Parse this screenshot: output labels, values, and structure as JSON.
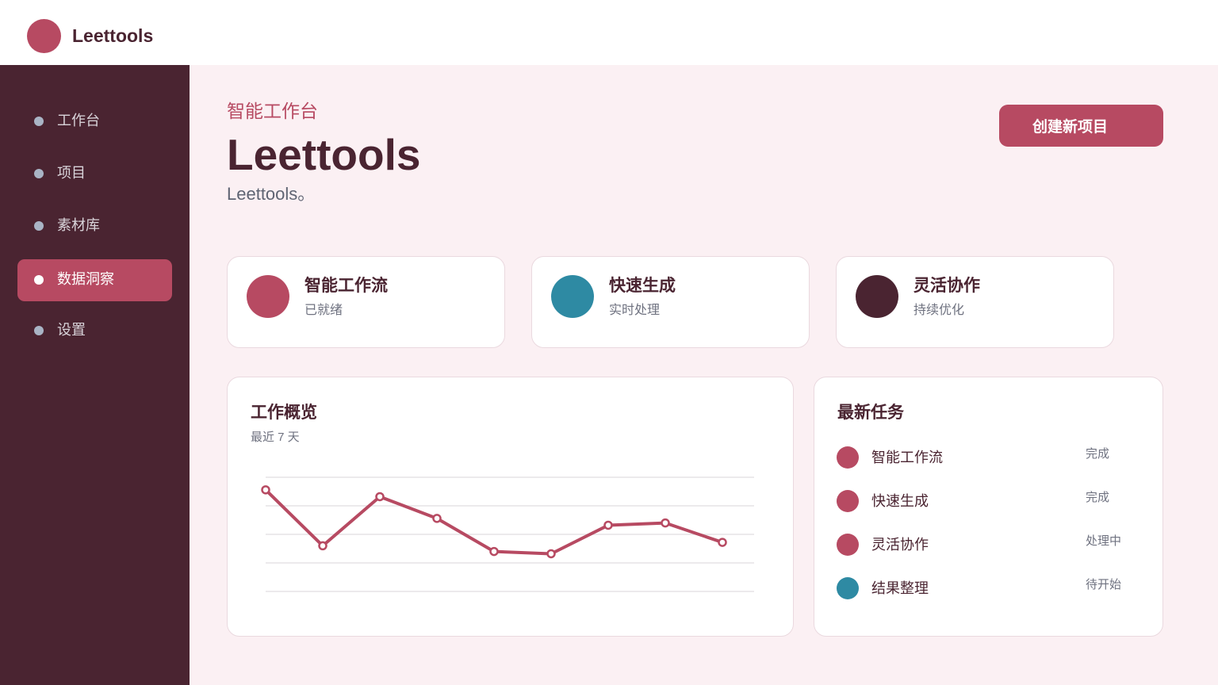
{
  "app": {
    "name": "Leettools"
  },
  "sidebar": {
    "items": [
      {
        "label": "工作台",
        "active": false
      },
      {
        "label": "项目",
        "active": false
      },
      {
        "label": "素材库",
        "active": false
      },
      {
        "label": "数据洞察",
        "active": true
      },
      {
        "label": "设置",
        "active": false
      }
    ]
  },
  "header": {
    "eyebrow": "智能工作台",
    "title": "Leettools",
    "subtitle": "Leettools。",
    "create_button": "创建新项目"
  },
  "features": [
    {
      "title": "智能工作流",
      "subtitle": "已就绪",
      "color": "#b74a62"
    },
    {
      "title": "快速生成",
      "subtitle": "实时处理",
      "color": "#2e8aa3"
    },
    {
      "title": "灵活协作",
      "subtitle": "持续优化",
      "color": "#4a2431"
    }
  ],
  "overview": {
    "title": "工作概览",
    "subtitle": "最近 7 天",
    "chart_data": {
      "type": "line",
      "series": [
        {
          "values": [
            89,
            40,
            83,
            64,
            35,
            33,
            58,
            60,
            43
          ]
        }
      ],
      "ylim": [
        0,
        100
      ],
      "grid": true,
      "color": "#b74a62"
    }
  },
  "tasks": {
    "title": "最新任务",
    "items": [
      {
        "name": "智能工作流",
        "status": "完成",
        "color": "#b74a62"
      },
      {
        "name": "快速生成",
        "status": "完成",
        "color": "#b74a62"
      },
      {
        "name": "灵活协作",
        "status": "处理中",
        "color": "#b74a62"
      },
      {
        "name": "结果整理",
        "status": "待开始",
        "color": "#2e8aa3"
      }
    ]
  },
  "colors": {
    "accent": "#b74a62",
    "sidebar": "#4a2431",
    "teal": "#2e8aa3",
    "background": "#fbf0f3"
  }
}
